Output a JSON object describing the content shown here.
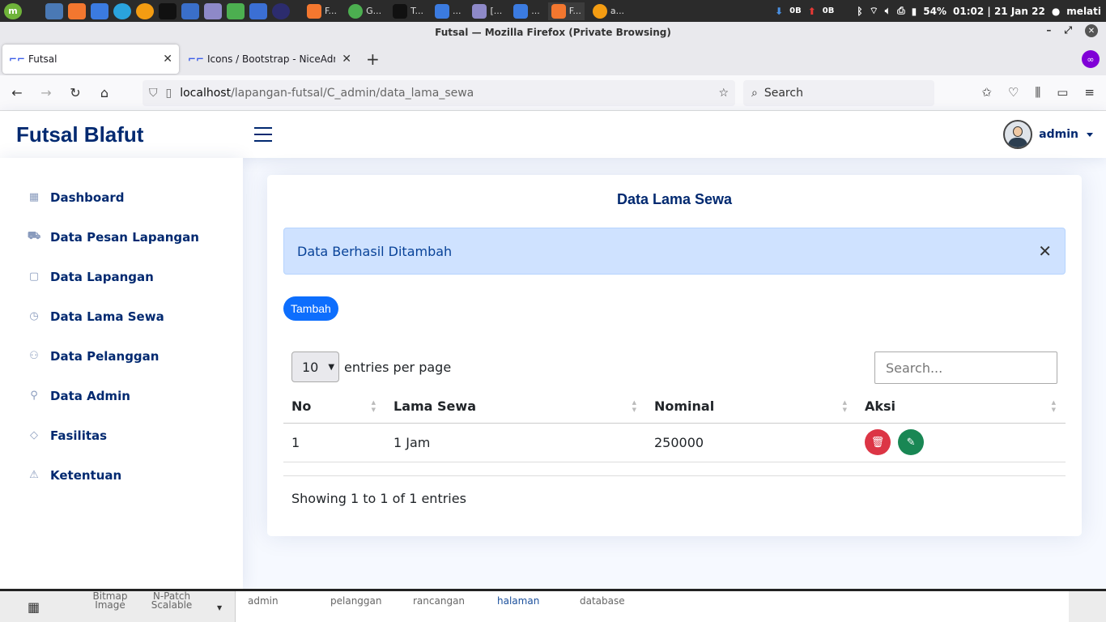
{
  "os": {
    "tasks": [
      {
        "label": "F..."
      },
      {
        "label": "G..."
      },
      {
        "label": "T..."
      },
      {
        "label": "..."
      },
      {
        "label": "[..."
      },
      {
        "label": "..."
      },
      {
        "label": "F..."
      },
      {
        "label": "a..."
      }
    ],
    "net_down": "0B",
    "net_up": "0B",
    "battery": "54%",
    "clock": "01:02 | 21 Jan 22",
    "user": "melati"
  },
  "window": {
    "title": "Futsal — Mozilla Firefox (Private Browsing)"
  },
  "tabs": [
    {
      "label": "Futsal"
    },
    {
      "label": "Icons / Bootstrap - NiceAdm"
    }
  ],
  "url": {
    "host": "localhost",
    "path": "/lapangan-futsal/C_admin/data_lama_sewa"
  },
  "browser_search": {
    "placeholder": "Search"
  },
  "app": {
    "brand": "Futsal Blafut",
    "user_name": "admin"
  },
  "sidebar": {
    "items": [
      {
        "label": "Dashboard",
        "icon": "grid-icon"
      },
      {
        "label": "Data Pesan Lapangan",
        "icon": "cart-icon"
      },
      {
        "label": "Data Lapangan",
        "icon": "clipboard-icon"
      },
      {
        "label": "Data Lama Sewa",
        "icon": "clock-icon"
      },
      {
        "label": "Data Pelanggan",
        "icon": "people-icon"
      },
      {
        "label": "Data Admin",
        "icon": "person-icon"
      },
      {
        "label": "Fasilitas",
        "icon": "gem-icon"
      },
      {
        "label": "Ketentuan",
        "icon": "warning-icon"
      }
    ]
  },
  "main": {
    "title": "Data Lama Sewa",
    "alert": "Data Berhasil Ditambah",
    "add_button": "Tambah",
    "per_page_value": "10",
    "per_page_label": "entries per page",
    "search_placeholder": "Search...",
    "columns": [
      "No",
      "Lama Sewa",
      "Nominal",
      "Aksi"
    ],
    "rows": [
      {
        "no": "1",
        "lama_sewa": "1 Jam",
        "nominal": "250000"
      }
    ],
    "info": "Showing 1 to 1 of 1 entries"
  },
  "underlying_app": {
    "items": [
      "Bitmap Image",
      "N-Patch Scalable",
      "admin",
      "pelanggan",
      "rancangan",
      "halaman",
      "database"
    ]
  }
}
